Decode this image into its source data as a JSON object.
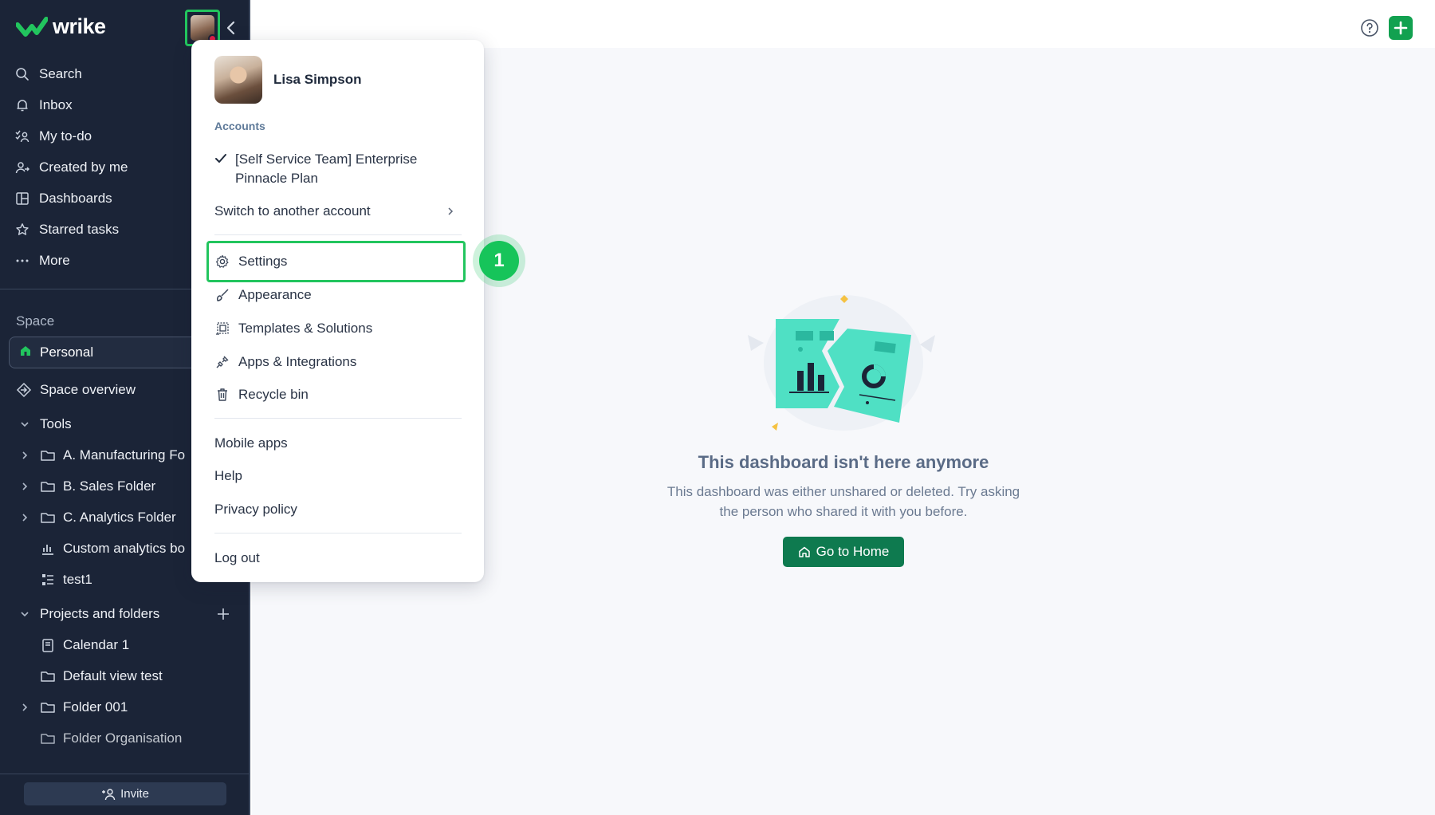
{
  "app": {
    "logo_text": "wrike"
  },
  "sidebar": {
    "nav": [
      {
        "label": "Search",
        "icon": "search-icon"
      },
      {
        "label": "Inbox",
        "icon": "bell-icon"
      },
      {
        "label": "My to-do",
        "icon": "todo-icon"
      },
      {
        "label": "Created by me",
        "icon": "user-arrow-icon"
      },
      {
        "label": "Dashboards",
        "icon": "dashboard-icon"
      },
      {
        "label": "Starred tasks",
        "icon": "star-icon"
      },
      {
        "label": "More",
        "icon": "ellipsis-icon"
      }
    ],
    "space_label": "Space",
    "space_selected": "Personal",
    "space_overview": "Space overview",
    "tools": {
      "label": "Tools",
      "items": [
        "A. Manufacturing Fo",
        "B. Sales Folder",
        "C. Analytics Folder",
        "Custom analytics bo",
        "test1"
      ]
    },
    "projects": {
      "label": "Projects and folders",
      "items": [
        "Calendar 1",
        "Default view test",
        "Folder 001",
        "Folder Organisation"
      ]
    },
    "invite_label": "Invite"
  },
  "dropdown": {
    "user_name": "Lisa Simpson",
    "accounts_label": "Accounts",
    "current_account": "[Self Service Team] Enterprise Pinnacle Plan",
    "switch_account": "Switch to another account",
    "menu": [
      {
        "label": "Settings",
        "icon": "gear-icon"
      },
      {
        "label": "Appearance",
        "icon": "brush-icon"
      },
      {
        "label": "Templates & Solutions",
        "icon": "templates-icon"
      },
      {
        "label": "Apps & Integrations",
        "icon": "plug-icon"
      },
      {
        "label": "Recycle bin",
        "icon": "trash-icon"
      }
    ],
    "links": [
      "Mobile apps",
      "Help",
      "Privacy policy"
    ],
    "logout": "Log out"
  },
  "step_badge": "1",
  "main": {
    "empty_title": "This dashboard isn't here anymore",
    "empty_desc_line1": "This dashboard was either unshared or deleted. Try asking",
    "empty_desc_line2": "the person who shared it with you before.",
    "home_button": "Go to Home"
  },
  "colors": {
    "sidebar_bg": "#1b2437",
    "accent_green": "#22c55e",
    "primary_button": "#0e7a4f",
    "illustration_teal": "#4fe0c4"
  }
}
